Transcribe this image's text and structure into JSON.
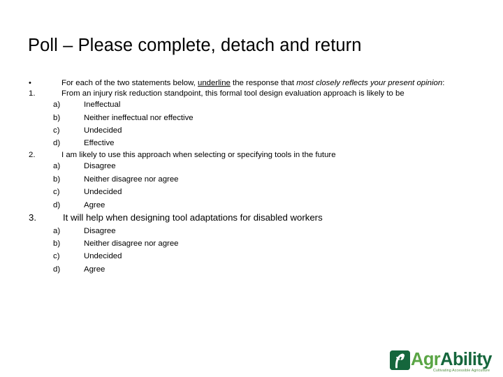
{
  "slide": {
    "title": "Poll – Please complete, detach and return"
  },
  "instruction": {
    "marker": "•",
    "text_before_underline": "For each of the two statements below, ",
    "underlined_word": "underline",
    "text_after_underline": " the response that ",
    "italic_phrase": "most closely reflects your present opinion",
    "trailing": ":"
  },
  "questions": [
    {
      "marker": "1.",
      "text": "From an injury risk reduction standpoint, this formal tool design evaluation approach is likely to be",
      "options": [
        {
          "marker": "a)",
          "label": "Ineffectual"
        },
        {
          "marker": "b)",
          "label": "Neither ineffectual nor effective"
        },
        {
          "marker": "c)",
          "label": "Undecided"
        },
        {
          "marker": "d)",
          "label": "Effective"
        }
      ]
    },
    {
      "marker": "2.",
      "text": "I am likely to use this approach when selecting or specifying tools in the future",
      "options": [
        {
          "marker": "a)",
          "label": "Disagree"
        },
        {
          "marker": "b)",
          "label": "Neither disagree nor agree"
        },
        {
          "marker": "c)",
          "label": "Undecided"
        },
        {
          "marker": "d)",
          "label": "Agree"
        }
      ]
    },
    {
      "marker": "3.",
      "text": "It will help when designing tool adaptations for disabled workers",
      "options": [
        {
          "marker": "a)",
          "label": "Disagree"
        },
        {
          "marker": "b)",
          "label": "Neither disagree nor agree"
        },
        {
          "marker": "c)",
          "label": "Undecided"
        },
        {
          "marker": "d)",
          "label": "Agree"
        }
      ]
    }
  ],
  "logo": {
    "name_part1": "Agr",
    "name_part2": "Ability",
    "tagline": "Cultivating Accessible Agriculture",
    "mark_color": "#15663c",
    "part1_color": "#5aa545",
    "part2_color": "#15663c"
  }
}
